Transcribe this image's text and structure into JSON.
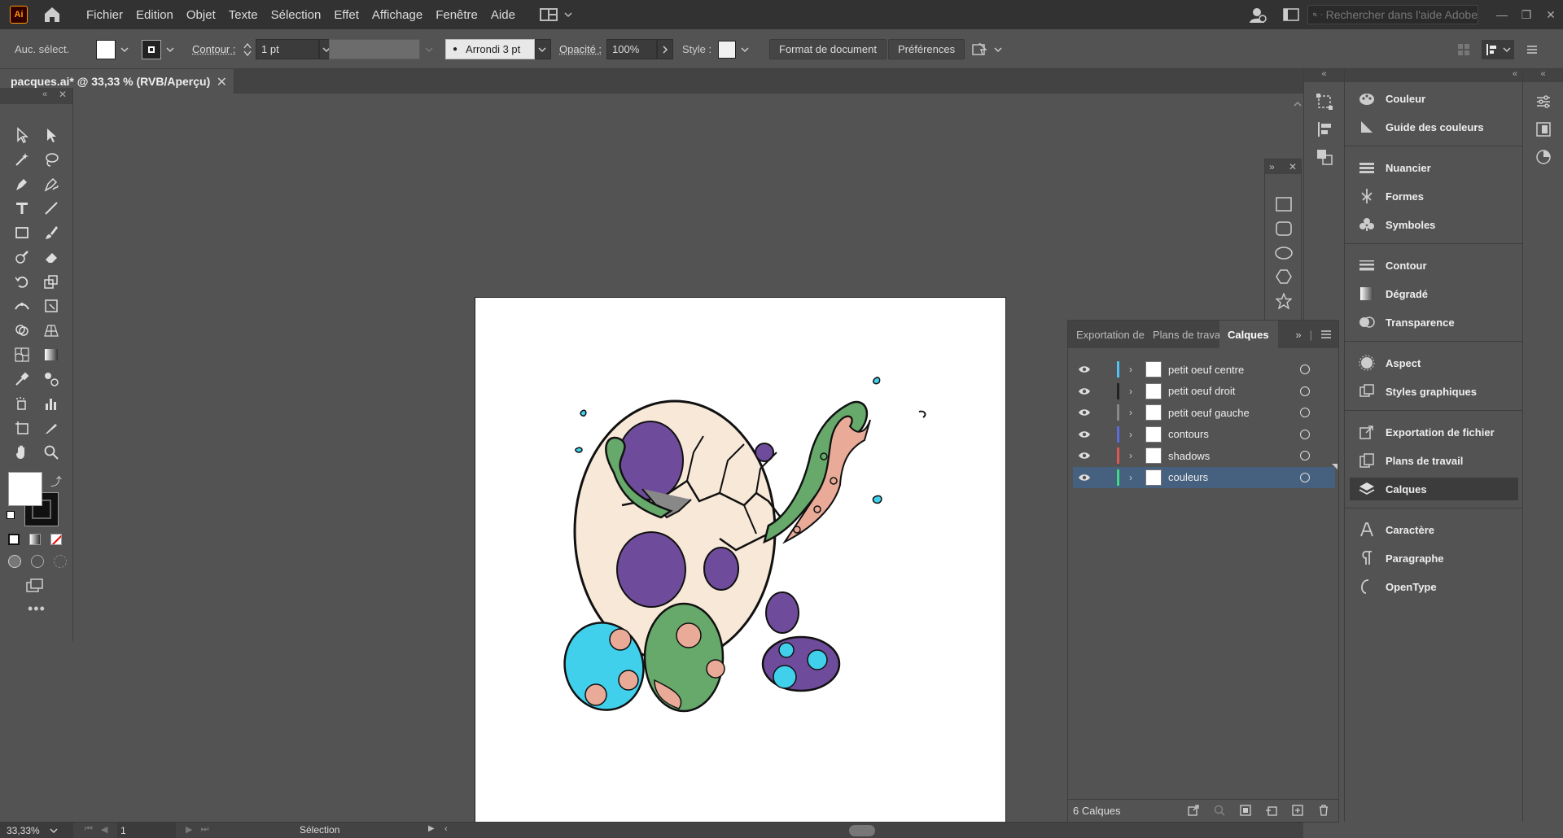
{
  "app": {
    "logo": "Ai"
  },
  "menu": [
    "Fichier",
    "Edition",
    "Objet",
    "Texte",
    "Sélection",
    "Effet",
    "Affichage",
    "Fenêtre",
    "Aide"
  ],
  "search": {
    "placeholder": "Rechercher dans l'aide Adobe"
  },
  "control_bar": {
    "selection_label": "Auc. sélect.",
    "stroke_label": "Contour :",
    "stroke_value": "1 pt",
    "brush_label": "Arrondi 3 pt",
    "opacity_label": "Opacité :",
    "opacity_value": "100%",
    "style_label": "Style :",
    "doc_format_btn": "Format de document",
    "prefs_btn": "Préférences"
  },
  "document": {
    "tab_title": "pacques.ai* @ 33,33 % (RVB/Aperçu)"
  },
  "layers_panel": {
    "tabs": [
      "Exportation de",
      "Plans de travai",
      "Calques"
    ],
    "active_tab": "Calques",
    "layers": [
      {
        "name": "petit oeuf centre",
        "color": "#4fc3f7",
        "selected": false
      },
      {
        "name": "petit oeuf droit",
        "color": "#222222",
        "selected": false
      },
      {
        "name": "petit oeuf gauche",
        "color": "#888888",
        "selected": false
      },
      {
        "name": "contours",
        "color": "#5b6ee1",
        "selected": false
      },
      {
        "name": "shadows",
        "color": "#e05555",
        "selected": false
      },
      {
        "name": "couleurs",
        "color": "#3ddc84",
        "selected": true
      }
    ],
    "footer_count": "6 Calques"
  },
  "right_dock": {
    "groups": [
      [
        "Couleur",
        "Guide des couleurs"
      ],
      [
        "Nuancier",
        "Formes",
        "Symboles"
      ],
      [
        "Contour",
        "Dégradé",
        "Transparence"
      ],
      [
        "Aspect",
        "Styles graphiques"
      ],
      [
        "Exportation de fichier",
        "Plans de travail",
        "Calques"
      ],
      [
        "Caractère",
        "Paragraphe",
        "OpenType"
      ]
    ],
    "active": "Calques"
  },
  "status_bar": {
    "zoom": "33,33%",
    "artboard_num": "1",
    "tool_name": "Sélection"
  },
  "colors": {
    "accent_selected": "#46607f",
    "egg_cream": "#f8e8d8",
    "spot_purple": "#6f4c9b",
    "tentacle_green": "#66a96b",
    "tentacle_pink": "#e9aa98",
    "small_egg_cyan": "#40d0ec"
  }
}
